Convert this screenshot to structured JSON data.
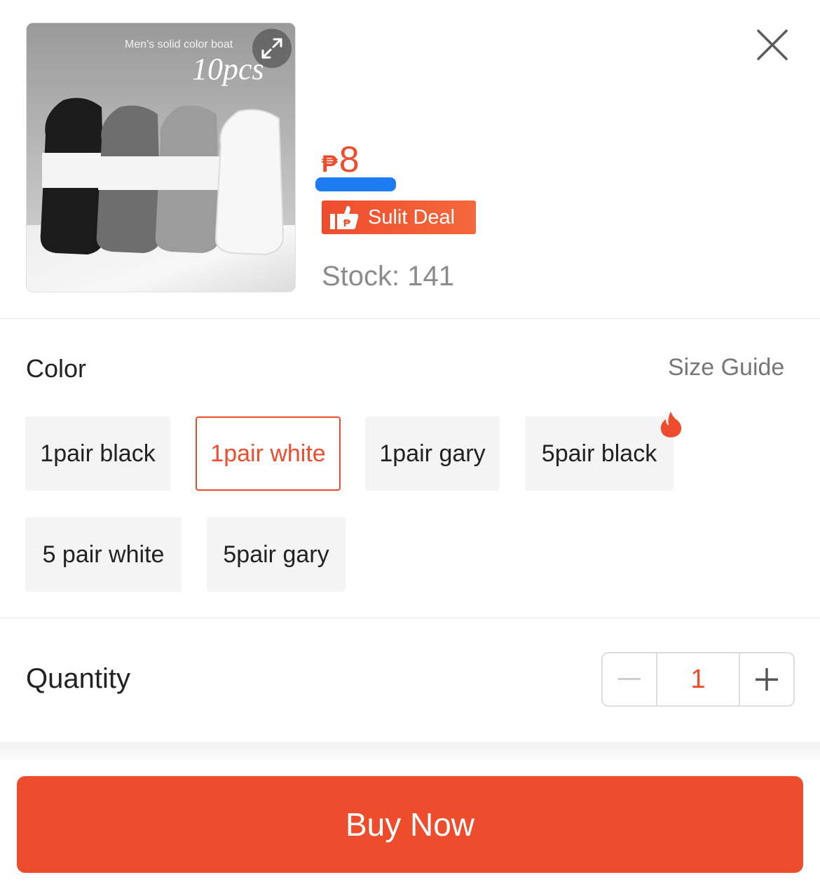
{
  "product": {
    "image_caption": "Men's solid color boat",
    "image_count_label": "10pcs",
    "price_currency": "₱",
    "price_value": "8",
    "deal_label": "Sulit Deal",
    "stock_text": "Stock: 141"
  },
  "variation": {
    "label": "Color",
    "size_guide_label": "Size Guide",
    "options": [
      {
        "label": "1pair black",
        "selected": false
      },
      {
        "label": "1pair white",
        "selected": true
      },
      {
        "label": "1pair gary",
        "selected": false
      },
      {
        "label": "5pair black",
        "selected": false,
        "hot": true
      },
      {
        "label": "5 pair white",
        "selected": false
      },
      {
        "label": "5pair gary",
        "selected": false
      }
    ]
  },
  "quantity": {
    "label": "Quantity",
    "value": "1"
  },
  "actions": {
    "buy_now_label": "Buy Now"
  },
  "icons": {
    "close": "close-icon",
    "expand": "expand-icon",
    "deal": "thumbs-up-peso-icon",
    "hot": "fire-icon",
    "minus": "minus-icon",
    "plus": "plus-icon"
  },
  "colors": {
    "accent": "#ee4d2d",
    "muted_text": "#8b8b8b",
    "chip_bg": "#f4f4f4"
  }
}
